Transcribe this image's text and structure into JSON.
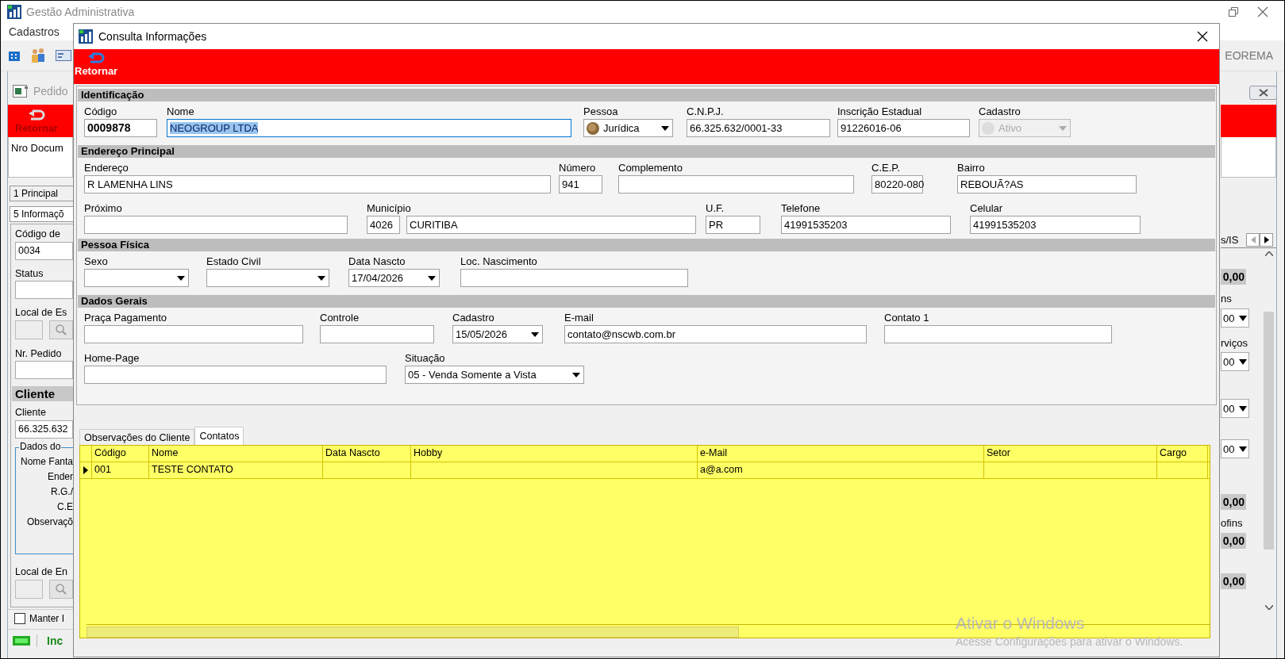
{
  "app": {
    "title": "Gestão Administrativa",
    "menu": [
      "Cadastros"
    ],
    "toolbar_text": "EOREMA"
  },
  "child_window": {
    "title": "Pedido",
    "return_label": "Retornar",
    "doc_label": "Nro Docum",
    "tabs": [
      {
        "label": "1 Principal",
        "selected": false
      },
      {
        "label": "5 Informaçõ",
        "selected": true
      }
    ],
    "left_panel": [
      {
        "kind": "label",
        "text": "Código de"
      },
      {
        "kind": "input",
        "value": "0034"
      },
      {
        "kind": "label",
        "text": "Status"
      },
      {
        "kind": "input"
      },
      {
        "kind": "label",
        "text": "Local de Es"
      },
      {
        "kind": "search"
      },
      {
        "kind": "label",
        "text": "Nr. Pedido"
      },
      {
        "kind": "input"
      },
      {
        "kind": "header",
        "text": "Cliente"
      },
      {
        "kind": "label",
        "text": "Cliente"
      },
      {
        "kind": "input",
        "value": "66.325.632"
      },
      {
        "kind": "group",
        "text": "Dados do",
        "labels": [
          "Nome Fanta",
          "Ender",
          "R.G./",
          "C.E",
          "Observaçõ"
        ]
      },
      {
        "kind": "label",
        "text": "Local de En"
      },
      {
        "kind": "search"
      }
    ],
    "checkbox": {
      "label": "Manter I",
      "checked": false
    },
    "status_text": "Inc",
    "nav_text": "s/IS",
    "right_panel": [
      {
        "kind": "total",
        "value": "0,00"
      },
      {
        "kind": "label",
        "text": "ns"
      },
      {
        "kind": "combo",
        "value": "00"
      },
      {
        "kind": "label",
        "text": "rviços"
      },
      {
        "kind": "combo",
        "value": "00"
      },
      {
        "kind": "combo",
        "value": "00"
      },
      {
        "kind": "combo",
        "value": "00"
      },
      {
        "kind": "total",
        "value": "0,00"
      },
      {
        "kind": "label",
        "text": "ofins"
      },
      {
        "kind": "total",
        "value": "0,00"
      },
      {
        "kind": "total",
        "value": "0,00"
      }
    ]
  },
  "dialog": {
    "title": "Consulta Informações",
    "return_label": "Retornar",
    "sections": [
      {
        "title": "Identificação",
        "rows": [
          {
            "fields": [
              {
                "label": "Código",
                "kind": "code",
                "value": "0009878",
                "disabled": false,
                "highlighted": false
              },
              {
                "label": "Nome",
                "kind": "text",
                "value": "NEOGROUP LTDA",
                "disabled": false,
                "highlighted": true
              },
              {
                "label": "Pessoa",
                "kind": "combo",
                "value": "Jurídica",
                "icon": true,
                "disabled": false,
                "highlighted": false
              },
              {
                "label": "C.N.P.J.",
                "kind": "text",
                "value": "66.325.632/0001-33",
                "disabled": false,
                "highlighted": false
              },
              {
                "label": "Inscrição Estadual",
                "kind": "text",
                "value": "91226016-06",
                "disabled": false,
                "highlighted": false
              },
              {
                "label": "Cadastro",
                "kind": "combo",
                "value": "Ativo",
                "icon": true,
                "disabled": true,
                "highlighted": false
              }
            ]
          }
        ]
      },
      {
        "title": "Endereço Principal",
        "rows": [
          {
            "fields": [
              {
                "label": "Endereço",
                "kind": "text",
                "value": "R LAMENHA LINS",
                "disabled": false,
                "highlighted": false
              },
              {
                "label": "Número",
                "kind": "text",
                "value": "941",
                "disabled": false,
                "highlighted": false
              },
              {
                "label": "Complemento",
                "kind": "text",
                "disabled": false,
                "highlighted": false
              },
              {
                "label": "C.E.P.",
                "kind": "text",
                "value": "80220-080",
                "disabled": false,
                "highlighted": false
              },
              {
                "label": "Bairro",
                "kind": "text",
                "value": "REBOUÃ?AS",
                "disabled": false,
                "highlighted": false
              }
            ]
          },
          {
            "fields": [
              {
                "label": "Próximo",
                "kind": "text",
                "disabled": false,
                "highlighted": false
              },
              {
                "label": "Município",
                "kind": "pair",
                "values": [
                  "4026",
                  "CURITIBA"
                ],
                "disabled": false,
                "highlighted": false
              },
              {
                "label": "U.F.",
                "kind": "text",
                "value": "PR",
                "disabled": false,
                "highlighted": false
              },
              {
                "label": "Telefone",
                "kind": "text",
                "value": "41991535203",
                "disabled": false,
                "highlighted": false
              },
              {
                "label": "Celular",
                "kind": "text",
                "value": "41991535203",
                "disabled": false,
                "highlighted": false
              }
            ]
          }
        ]
      },
      {
        "title": "Pessoa Física",
        "rows": [
          {
            "fields": [
              {
                "label": "Sexo",
                "kind": "combo",
                "disabled": false,
                "highlighted": false
              },
              {
                "label": "Estado Civil",
                "kind": "combo",
                "disabled": false,
                "highlighted": false
              },
              {
                "label": "Data Nascto",
                "kind": "combo",
                "value": "17/04/2026",
                "disabled": false,
                "highlighted": false
              },
              {
                "label": "Loc. Nascimento",
                "kind": "text",
                "disabled": false,
                "highlighted": false
              }
            ]
          }
        ]
      },
      {
        "title": "Dados Gerais",
        "rows": [
          {
            "fields": [
              {
                "label": "Praça Pagamento",
                "kind": "text",
                "disabled": false,
                "highlighted": false
              },
              {
                "label": "Controle",
                "kind": "text",
                "disabled": false,
                "highlighted": false
              },
              {
                "label": "Cadastro",
                "kind": "combo",
                "value": "15/05/2026",
                "disabled": false,
                "highlighted": false
              },
              {
                "label": "E-mail",
                "kind": "text",
                "value": "contato@nscwb.com.br",
                "disabled": false,
                "highlighted": false
              },
              {
                "label": "Contato 1",
                "kind": "text",
                "disabled": false,
                "highlighted": false
              }
            ]
          },
          {
            "fields": [
              {
                "label": "Home-Page",
                "kind": "text",
                "disabled": false,
                "highlighted": false
              },
              {
                "label": "Situação",
                "kind": "combo",
                "value": "05 - Venda Somente a Vista",
                "disabled": false,
                "highlighted": false
              }
            ]
          }
        ]
      }
    ],
    "tabs": [
      {
        "label": "Observações do Cliente",
        "selected": false
      },
      {
        "label": "Contatos",
        "selected": true
      }
    ],
    "grid": {
      "columns": [
        "Código",
        "Nome",
        "Data Nascto",
        "Hobby",
        "e-Mail",
        "Setor",
        "Cargo"
      ],
      "rows": [
        {
          "current": true,
          "cells": [
            "001",
            "TESTE CONTATO",
            null,
            null,
            "a@a.com",
            null,
            null
          ]
        }
      ]
    }
  },
  "activation": {
    "title": "Ativar o Windows",
    "text": "Acesse Configurações para ativar o Windows."
  }
}
